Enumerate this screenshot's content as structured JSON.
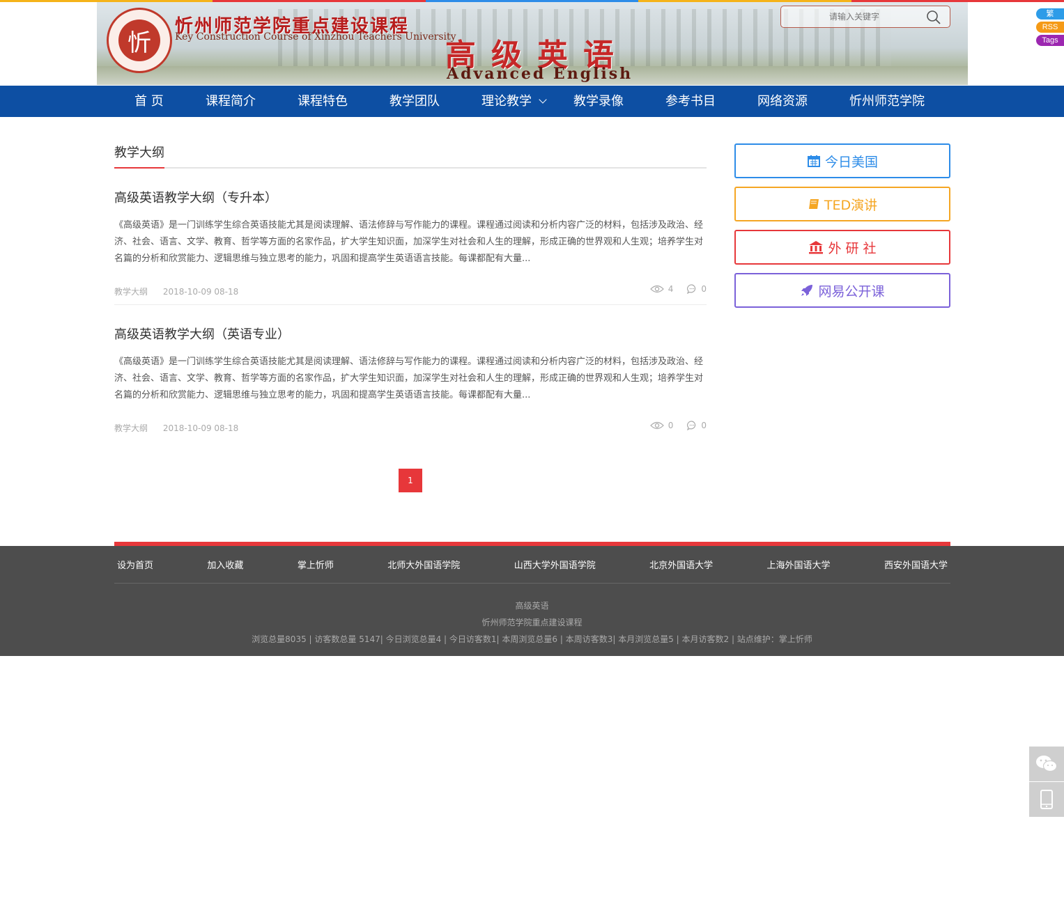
{
  "top_strip_colors": [
    "#f5b31a",
    "#e7373a",
    "#2d8ce8",
    "#f5b31a",
    "#e7373a"
  ],
  "banner": {
    "seal_char": "忻",
    "title_cn": "忻州师范学院重点建设课程",
    "title_en": "Key Construction Course of Xinzhou Teachers University",
    "course_cn": "高级英语",
    "course_en": "Advanced English"
  },
  "search": {
    "placeholder": "请输入关键字"
  },
  "side_tags": [
    {
      "label": "繁",
      "color": "#2d9ce8"
    },
    {
      "label": "RSS",
      "color": "#f59a16"
    },
    {
      "label": "Tags",
      "color": "#9c27b0"
    }
  ],
  "nav": {
    "items": [
      {
        "label": "首 页"
      },
      {
        "label": "课程简介"
      },
      {
        "label": "课程特色"
      },
      {
        "label": "教学团队"
      },
      {
        "label": "理论教学",
        "has_dropdown": true
      },
      {
        "label": "教学录像"
      },
      {
        "label": "参考书目"
      },
      {
        "label": "网络资源"
      },
      {
        "label": "忻州师范学院"
      }
    ]
  },
  "section": {
    "title": "教学大纲"
  },
  "posts": [
    {
      "title": "高级英语教学大纲（专升本）",
      "excerpt": "《高级英语》是一门训练学生综合英语技能尤其是阅读理解、语法修辞与写作能力的课程。课程通过阅读和分析内容广泛的材料，包括涉及政治、经济、社会、语言、文学、教育、哲学等方面的名家作品，扩大学生知识面，加深学生对社会和人生的理解，形成正确的世界观和人生观；培养学生对名篇的分析和欣赏能力、逻辑思维与独立思考的能力，巩固和提高学生英语语言技能。每课都配有大量...",
      "category": "教学大纲",
      "date": "2018-10-09 08-18",
      "views": "4",
      "comments": "0"
    },
    {
      "title": "高级英语教学大纲（英语专业）",
      "excerpt": "《高级英语》是一门训练学生综合英语技能尤其是阅读理解、语法修辞与写作能力的课程。课程通过阅读和分析内容广泛的材料，包括涉及政治、经济、社会、语言、文学、教育、哲学等方面的名家作品，扩大学生知识面，加深学生对社会和人生的理解，形成正确的世界观和人生观；培养学生对名篇的分析和欣赏能力、逻辑思维与独立思考的能力，巩固和提高学生英语语言技能。每课都配有大量...",
      "category": "教学大纲",
      "date": "2018-10-09 08-18",
      "views": "0",
      "comments": "0"
    }
  ],
  "pagination": {
    "current": "1"
  },
  "sidebar": {
    "buttons": [
      {
        "label": "今日美国",
        "icon": "calendar-icon",
        "color": "#2d8ce8"
      },
      {
        "label": "TED演讲",
        "icon": "book-icon",
        "color": "#f5a623"
      },
      {
        "label": "外 研 社",
        "icon": "institution-icon",
        "color": "#e7373a"
      },
      {
        "label": "网易公开课",
        "icon": "rocket-icon",
        "color": "#7b61d9"
      }
    ]
  },
  "footer": {
    "links": [
      "设为首页",
      "加入收藏",
      "掌上忻师",
      "北师大外国语学院",
      "山西大学外国语学院",
      "北京外国语大学",
      "上海外国语大学",
      "西安外国语大学"
    ],
    "line1": "高级英语",
    "line2": "忻州师范学院重点建设课程",
    "line3": "浏览总量8035 | 访客数总量 5147| 今日浏览总量4 | 今日访客数1| 本周浏览总量6 | 本周访客数3| 本月浏览总量5 | 本月访客数2 | 站点维护：掌上忻师"
  },
  "float_buttons": [
    "wechat-icon",
    "mobile-icon"
  ]
}
